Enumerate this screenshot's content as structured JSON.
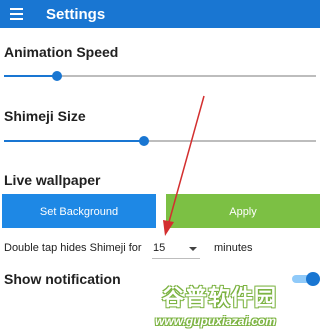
{
  "appbar": {
    "title": "Settings",
    "menu_icon": "hamburger-menu-icon",
    "color": "#1976d2"
  },
  "animation_speed": {
    "label": "Animation Speed",
    "level": 0.17
  },
  "shimeji_size": {
    "label": "Shimeji Size",
    "level": 0.45
  },
  "live_wallpaper": {
    "label": "Live wallpaper",
    "set_background_label": "Set Background",
    "apply_label": "Apply",
    "set_background_color": "#1e88e5",
    "apply_color": "#7cc044"
  },
  "double_tap": {
    "label": "Double tap hides Shimeji for",
    "value": "15",
    "unit": "minutes",
    "dropdown_icon": "dropdown-arrow-icon"
  },
  "show_notification": {
    "label": "Show notification",
    "enabled": true
  },
  "overlay": {
    "arrow_color": "#d32f2f"
  },
  "watermark": {
    "title": "谷普软件园",
    "url": "www.gupuxiazai.com"
  }
}
